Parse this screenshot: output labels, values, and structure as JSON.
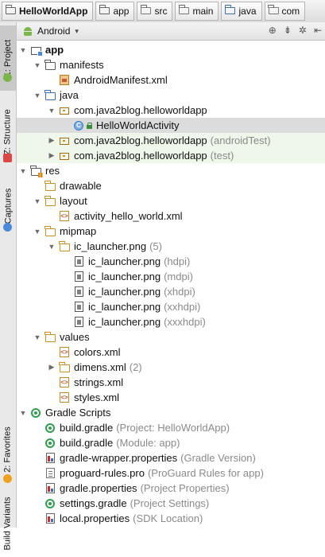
{
  "breadcrumb": [
    "HelloWorldApp",
    "app",
    "src",
    "main",
    "java",
    "com"
  ],
  "panel": {
    "title": "Android"
  },
  "left_tabs": {
    "project": "1: Project",
    "structure": "Z: Structure",
    "captures": "Captures",
    "favorites": "2: Favorites",
    "variants": "Build Variants"
  },
  "tree": [
    {
      "label": "app",
      "annotation": "",
      "depth": 0,
      "expand": "open",
      "icon": "module",
      "bold": true
    },
    {
      "label": "manifests",
      "annotation": "",
      "depth": 1,
      "expand": "open",
      "icon": "folder"
    },
    {
      "label": "AndroidManifest.xml",
      "annotation": "",
      "depth": 2,
      "expand": "none",
      "icon": "manifest"
    },
    {
      "label": "java",
      "annotation": "",
      "depth": 1,
      "expand": "open",
      "icon": "folder-blue"
    },
    {
      "label": "com.java2blog.helloworldapp",
      "annotation": "",
      "depth": 2,
      "expand": "open",
      "icon": "package"
    },
    {
      "label": "HelloWorldActivity",
      "annotation": "",
      "depth": 3,
      "expand": "none",
      "icon": "class",
      "selected": true
    },
    {
      "label": "com.java2blog.helloworldapp",
      "annotation": "(androidTest)",
      "depth": 2,
      "expand": "closed",
      "icon": "package",
      "highlight": true
    },
    {
      "label": "com.java2blog.helloworldapp",
      "annotation": "(test)",
      "depth": 2,
      "expand": "closed",
      "icon": "package",
      "highlight": true
    },
    {
      "label": "res",
      "annotation": "",
      "depth": 0,
      "expand": "open",
      "icon": "res-folder",
      "inset": true
    },
    {
      "label": "drawable",
      "annotation": "",
      "depth": 1,
      "expand": "none",
      "icon": "res-sub"
    },
    {
      "label": "layout",
      "annotation": "",
      "depth": 1,
      "expand": "open",
      "icon": "res-sub"
    },
    {
      "label": "activity_hello_world.xml",
      "annotation": "",
      "depth": 2,
      "expand": "none",
      "icon": "xml"
    },
    {
      "label": "mipmap",
      "annotation": "",
      "depth": 1,
      "expand": "open",
      "icon": "res-sub"
    },
    {
      "label": "ic_launcher.png",
      "annotation": "(5)",
      "depth": 2,
      "expand": "open",
      "icon": "res-sub"
    },
    {
      "label": "ic_launcher.png",
      "annotation": "(hdpi)",
      "depth": 3,
      "expand": "none",
      "icon": "png"
    },
    {
      "label": "ic_launcher.png",
      "annotation": "(mdpi)",
      "depth": 3,
      "expand": "none",
      "icon": "png"
    },
    {
      "label": "ic_launcher.png",
      "annotation": "(xhdpi)",
      "depth": 3,
      "expand": "none",
      "icon": "png"
    },
    {
      "label": "ic_launcher.png",
      "annotation": "(xxhdpi)",
      "depth": 3,
      "expand": "none",
      "icon": "png"
    },
    {
      "label": "ic_launcher.png",
      "annotation": "(xxxhdpi)",
      "depth": 3,
      "expand": "none",
      "icon": "png"
    },
    {
      "label": "values",
      "annotation": "",
      "depth": 1,
      "expand": "open",
      "icon": "res-sub"
    },
    {
      "label": "colors.xml",
      "annotation": "",
      "depth": 2,
      "expand": "none",
      "icon": "xml"
    },
    {
      "label": "dimens.xml",
      "annotation": "(2)",
      "depth": 2,
      "expand": "closed",
      "icon": "res-sub"
    },
    {
      "label": "strings.xml",
      "annotation": "",
      "depth": 2,
      "expand": "none",
      "icon": "xml"
    },
    {
      "label": "styles.xml",
      "annotation": "",
      "depth": 2,
      "expand": "none",
      "icon": "xml"
    },
    {
      "label": "Gradle Scripts",
      "annotation": "",
      "depth": 0,
      "expand": "open",
      "icon": "gradle"
    },
    {
      "label": "build.gradle",
      "annotation": "(Project: HelloWorldApp)",
      "depth": 1,
      "expand": "none",
      "icon": "gradle"
    },
    {
      "label": "build.gradle",
      "annotation": "(Module: app)",
      "depth": 1,
      "expand": "none",
      "icon": "gradle"
    },
    {
      "label": "gradle-wrapper.properties",
      "annotation": "(Gradle Version)",
      "depth": 1,
      "expand": "none",
      "icon": "props"
    },
    {
      "label": "proguard-rules.pro",
      "annotation": "(ProGuard Rules for app)",
      "depth": 1,
      "expand": "none",
      "icon": "txt"
    },
    {
      "label": "gradle.properties",
      "annotation": "(Project Properties)",
      "depth": 1,
      "expand": "none",
      "icon": "props"
    },
    {
      "label": "settings.gradle",
      "annotation": "(Project Settings)",
      "depth": 1,
      "expand": "none",
      "icon": "gradle"
    },
    {
      "label": "local.properties",
      "annotation": "(SDK Location)",
      "depth": 1,
      "expand": "none",
      "icon": "props"
    }
  ]
}
